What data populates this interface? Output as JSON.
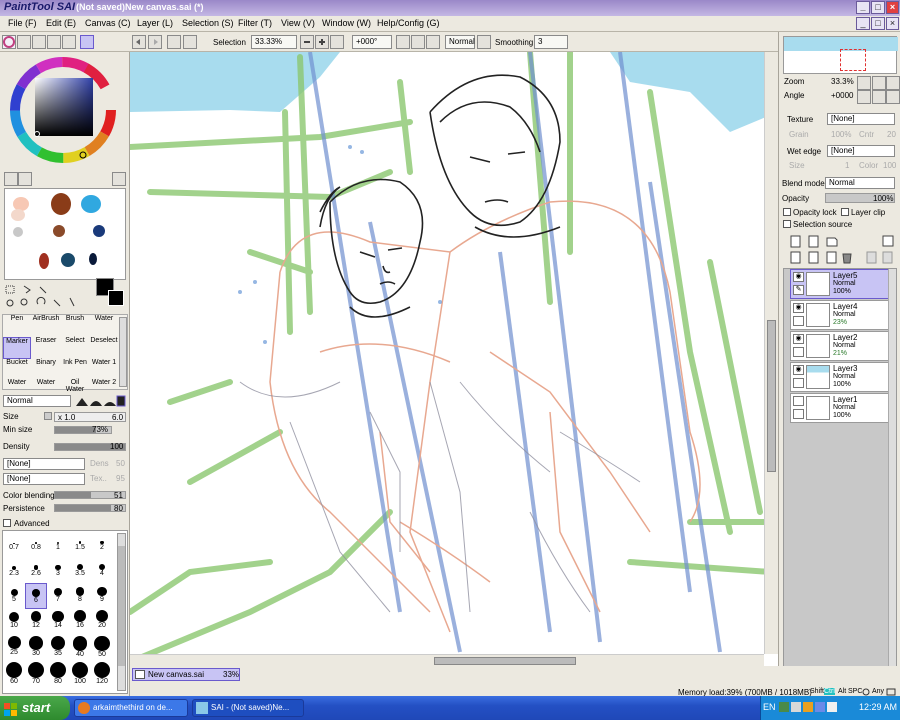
{
  "window": {
    "logo": "PaintTool SAI",
    "title": "(Not saved)New canvas.sai (*)"
  },
  "menu": [
    "File (F)",
    "Edit (E)",
    "Canvas (C)",
    "Layer (L)",
    "Selection (S)",
    "Filter (T)",
    "View (V)",
    "Window (W)",
    "Help/Config (G)"
  ],
  "toolbar": {
    "selection_label": "Selection",
    "zoom": "33.33%",
    "rotation": "+000°",
    "blend_mode": "Normal",
    "smoothing_label": "Smoothing",
    "smoothing_value": "3"
  },
  "navigator": {
    "zoom_label": "Zoom",
    "zoom_value": "33.3%",
    "angle_label": "Angle",
    "angle_value": "+0000"
  },
  "texture": {
    "texture_label": "Texture",
    "texture_value": "[None]",
    "grain_label": "Grain",
    "grain_value": "100%",
    "contrast_label": "Cntr",
    "contrast_value": "20",
    "wet_edge_label": "Wet edge",
    "wet_edge_value": "[None]",
    "size_label": "Size",
    "size_value": "1",
    "color_label": "Color",
    "color_value": "100"
  },
  "layer_props": {
    "blend_mode_label": "Blend mode",
    "blend_mode_value": "Normal",
    "opacity_label": "Opacity",
    "opacity_value": "100%",
    "opacity_lock_label": "Opacity lock",
    "layer_clip_label": "Layer clip",
    "selection_source_label": "Selection source"
  },
  "layers": [
    {
      "name": "Layer5",
      "mode": "Normal",
      "opacity": "100%",
      "visible": true,
      "active": true
    },
    {
      "name": "Layer4",
      "mode": "Normal",
      "opacity": "23%",
      "visible": true,
      "active": false
    },
    {
      "name": "Layer2",
      "mode": "Normal",
      "opacity": "21%",
      "visible": true,
      "active": false
    },
    {
      "name": "Layer3",
      "mode": "Normal",
      "opacity": "100%",
      "visible": true,
      "active": false
    },
    {
      "name": "Layer1",
      "mode": "Normal",
      "opacity": "100%",
      "visible": false,
      "active": false
    }
  ],
  "tools": [
    [
      "Pen",
      "AirBrush",
      "Brush",
      "Water"
    ],
    [
      "Marker",
      "Eraser",
      "Select",
      "Deselect"
    ],
    [
      "Bucket",
      "Binary",
      "Ink Pen",
      "Water 1"
    ],
    [
      "Water",
      "Water",
      "Oil Water",
      "Water 2"
    ]
  ],
  "brush": {
    "mode": "Normal",
    "size_label": "Size",
    "size_mult": "x 1.0",
    "size_value": "6.0",
    "min_size_label": "Min size",
    "min_size_value": "73%",
    "min_size_fraction": 0.73,
    "density_label": "Density",
    "density_value": "100",
    "density_fraction": 1.0,
    "shape1": "[None]",
    "shape1_label": "Dens",
    "shape1_value": "50",
    "shape2": "[None]",
    "shape2_label": "Tex..",
    "shape2_value": "95",
    "color_blending_label": "Color blending",
    "color_blending_value": "51",
    "color_blending_fraction": 0.51,
    "persistence_label": "Persistence",
    "persistence_value": "80",
    "persistence_fraction": 0.8,
    "advanced_label": "Advanced"
  },
  "brush_sizes": [
    "0.7",
    "0.8",
    "1",
    "1.5",
    "2",
    "2.3",
    "2.6",
    "3",
    "3.5",
    "4",
    "5",
    "6",
    "7",
    "8",
    "9",
    "10",
    "12",
    "14",
    "16",
    "20",
    "25",
    "30",
    "35",
    "40",
    "50",
    "60",
    "70",
    "80",
    "100",
    "120"
  ],
  "canvas_tab": {
    "name": "New canvas.sai",
    "zoom": "33%"
  },
  "status": {
    "memory": "Memory load:39% (700MB / 1018MB)",
    "keys": [
      "Shift",
      "Ctrl",
      "Alt",
      "SPC",
      "Any"
    ]
  },
  "taskbar": {
    "start_label": "start",
    "tasks": [
      "arkaimthethird on de...",
      "SAI - (Not saved)Ne..."
    ],
    "lang": "EN",
    "clock": "12:29 AM"
  },
  "colors": {
    "accent": "#6a5acd",
    "taskbar": "#2450c4",
    "titlebar": "#9a88c8"
  }
}
